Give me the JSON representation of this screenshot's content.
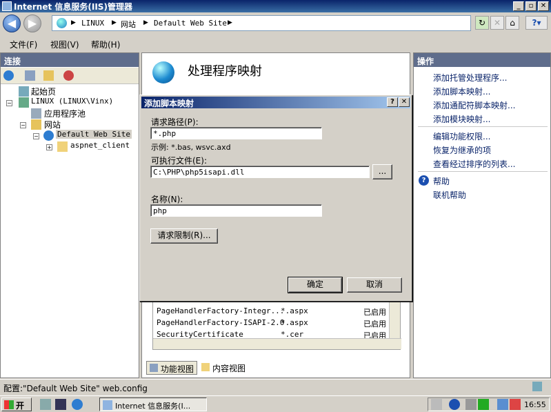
{
  "window": {
    "title": "Internet 信息服务(IIS)管理器",
    "min": "_",
    "max": "▫",
    "close": "✕"
  },
  "address": {
    "crumbs": [
      "LINUX",
      "网站",
      "Default Web Site"
    ]
  },
  "menubar": {
    "items": [
      "文件(F)",
      "视图(V)",
      "帮助(H)"
    ]
  },
  "left": {
    "title": "连接",
    "tree": [
      {
        "label": "起始页"
      },
      {
        "label": "LINUX (LINUX\\Vinx)"
      },
      {
        "label": "应用程序池"
      },
      {
        "label": "网站"
      },
      {
        "label": "Default Web Site"
      },
      {
        "label": "aspnet_client"
      }
    ]
  },
  "center": {
    "title": "处理程序映射",
    "rows": [
      {
        "name": "PageHandlerFactory-Integr...",
        "path": "*.aspx",
        "state": "已启用"
      },
      {
        "name": "PageHandlerFactory-ISAPI-2.0",
        "path": "*.aspx",
        "state": "已启用"
      },
      {
        "name": "SecurityCertificate",
        "path": "*.cer",
        "state": "已启用"
      }
    ],
    "tabs": [
      "功能视图",
      "内容视图"
    ]
  },
  "right": {
    "title": "操作",
    "actions1": [
      "添加托管处理程序...",
      "添加脚本映射...",
      "添加通配符脚本映射...",
      "添加模块映射..."
    ],
    "actions2": [
      "编辑功能权限...",
      "恢复为继承的项",
      "查看经过排序的列表..."
    ],
    "help": "帮助",
    "online_help": "联机帮助"
  },
  "dialog": {
    "title": "添加脚本映射",
    "help_btn": "?",
    "close_btn": "✕",
    "path_label": "请求路径(P):",
    "path_value": "*.php",
    "example": "示例: *.bas, wsvc.axd",
    "exe_label": "可执行文件(E):",
    "exe_value": "C:\\PHP\\php5isapi.dll",
    "browse": "...",
    "name_label": "名称(N):",
    "name_value": "php",
    "restrictions": "请求限制(R)...",
    "ok": "确定",
    "cancel": "取消"
  },
  "status": {
    "text": "配置:\"Default Web Site\" web.config"
  },
  "taskbar": {
    "start": "开始",
    "item": "Internet 信息服务(I...",
    "clock": "16:55"
  }
}
